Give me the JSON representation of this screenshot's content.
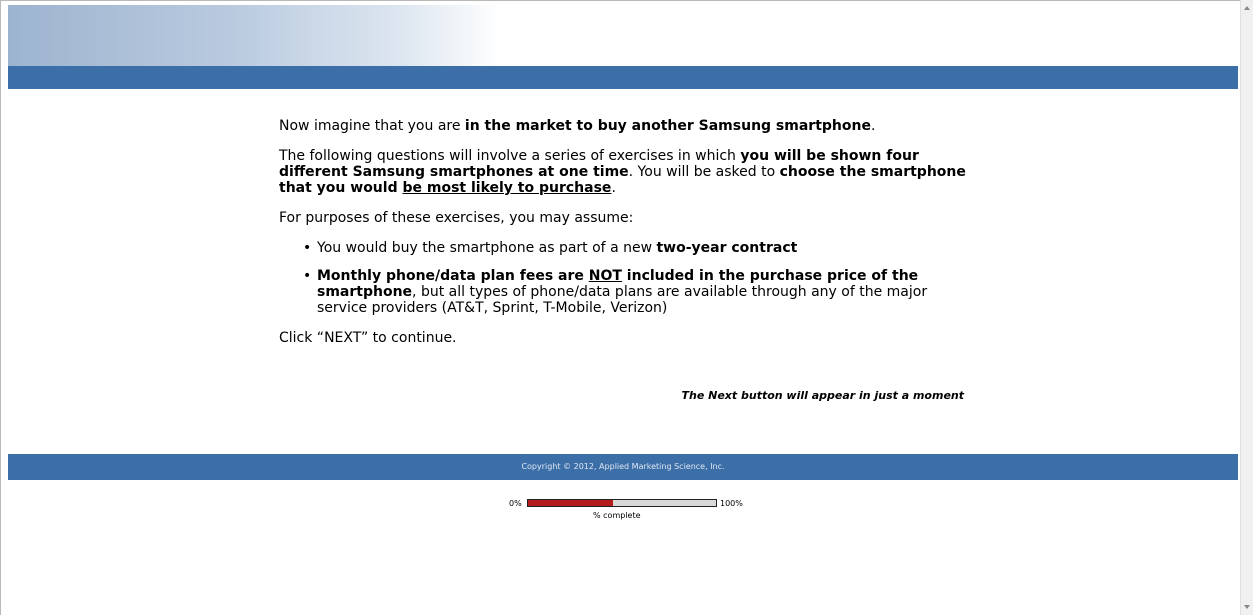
{
  "intro": {
    "p1_a": "Now imagine that you are ",
    "p1_b": "in the market to buy another Samsung smartphone",
    "p1_c": ".",
    "p2_a": "The following questions will involve a series of exercises in which ",
    "p2_b": "you will be shown four different Samsung smartphones at one time",
    "p2_c": ". You will be asked to ",
    "p2_d": "choose the smartphone that you would ",
    "p2_e": "be most likely to purchase",
    "p2_f": ".",
    "p3": "For purposes of these exercises, you may assume:",
    "bullet1_a": "You would buy the smartphone as part of a new ",
    "bullet1_b": "two-year contract",
    "bullet2_a": "Monthly phone/data plan fees are ",
    "bullet2_b": "NOT",
    "bullet2_c": " included in the purchase price of the smartphone",
    "bullet2_d": ", but all types of phone/data plans are available through any of the major service providers (AT&T, Sprint, T-Mobile, Verizon)",
    "p4": "Click “NEXT” to continue."
  },
  "next_note": "The Next button will appear in just a moment",
  "footer": {
    "copyright": "Copyright © 2012, Applied Marketing Science, Inc."
  },
  "progress": {
    "start_label": "0%",
    "end_label": "100%",
    "caption": "% complete",
    "value": 0.45,
    "fill_color": "#b51d1d"
  },
  "colors": {
    "header_bar": "#3c6ea8",
    "footer_bar": "#3c6ea8"
  }
}
